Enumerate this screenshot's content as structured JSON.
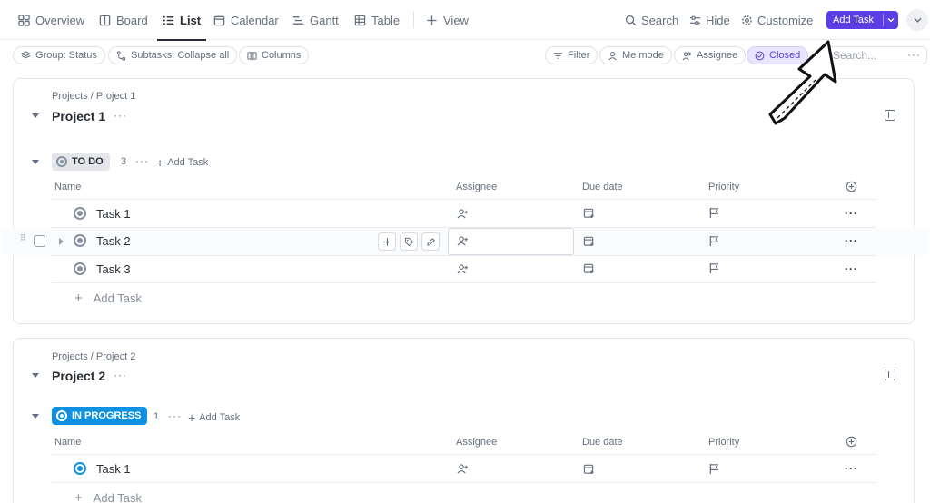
{
  "tabs": [
    {
      "label": "Overview",
      "icon": "overview-icon"
    },
    {
      "label": "Board",
      "icon": "board-icon"
    },
    {
      "label": "List",
      "icon": "list-icon",
      "active": true
    },
    {
      "label": "Calendar",
      "icon": "calendar-icon"
    },
    {
      "label": "Gantt",
      "icon": "gantt-icon"
    },
    {
      "label": "Table",
      "icon": "table-icon"
    },
    {
      "label": "View",
      "icon": "plus-icon"
    }
  ],
  "toolbar": {
    "search_label": "Search",
    "hide_label": "Hide",
    "customize_label": "Customize",
    "add_task_label": "Add Task"
  },
  "filters": {
    "group": "Group: Status",
    "subtasks": "Subtasks: Collapse all",
    "columns": "Columns",
    "filter": "Filter",
    "me_mode": "Me mode",
    "assignee": "Assignee",
    "closed": "Closed",
    "search_placeholder": "Search..."
  },
  "columns": {
    "name": "Name",
    "assignee": "Assignee",
    "due": "Due date",
    "priority": "Priority"
  },
  "projects": [
    {
      "crumb": "Projects / Project 1",
      "title": "Project 1",
      "status": "TO DO",
      "count": "3",
      "add_task": "Add Task",
      "tasks": [
        "Task 1",
        "Task 2",
        "Task 3"
      ],
      "add_row": "Add Task"
    },
    {
      "crumb": "Projects / Project 2",
      "title": "Project 2",
      "status": "IN PROGRESS",
      "count": "1",
      "add_task": "Add Task",
      "tasks": [
        "Task 1"
      ],
      "add_row": "Add Task"
    }
  ],
  "colors": {
    "accent": "#5b3ee6",
    "in_progress": "#1090e0",
    "todo": "#87909e"
  }
}
